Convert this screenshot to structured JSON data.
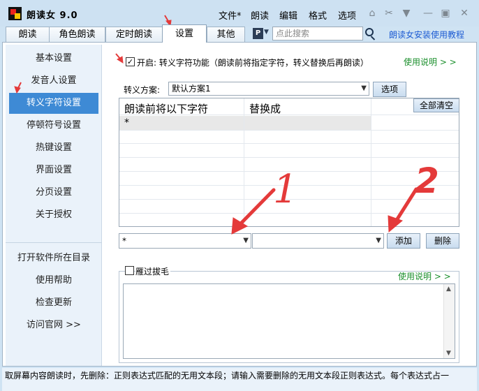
{
  "app": {
    "title": "朗读女  9.0"
  },
  "menu": [
    "文件*",
    "朗读",
    "编辑",
    "格式",
    "选项"
  ],
  "tabs": [
    "朗读",
    "角色朗读",
    "定时朗读",
    "设置",
    "其他"
  ],
  "search": {
    "placeholder": "点此搜索"
  },
  "tutorial_link": "朗读女安装使用教程",
  "sidebar": {
    "items": [
      "基本设置",
      "发音人设置",
      "转义字符设置",
      "停顿符号设置",
      "热键设置",
      "界面设置",
      "分页设置",
      "关于授权"
    ],
    "links": [
      "打开软件所在目录",
      "使用帮助",
      "检查更新",
      "访问官网 >>"
    ]
  },
  "escape": {
    "enable_label": "开启: 转义字符功能（朗读前将指定字符，转义替换后再朗读）",
    "help": "使用说明 > >",
    "scheme_label": "转义方案:",
    "scheme_value": "默认方案1",
    "options_button": "选项",
    "table": {
      "col_source": "朗读前将以下字符",
      "col_replace": "替换成",
      "clear_all": "全部清空",
      "rows": [
        {
          "source": "*",
          "replace": ""
        }
      ]
    },
    "input_source": "*",
    "input_replace": "",
    "add_button": "添加",
    "delete_button": "删除"
  },
  "skip": {
    "label": "雁过拔毛",
    "help": "使用说明 > >"
  },
  "status": "取屏幕内容朗读时，先删除：正则表达式匹配的无用文本段；请输入需要删除的无用文本段正则表达式。每个表达式占一",
  "annotations": [
    "1",
    "2"
  ],
  "colors": {
    "accent": "#3e8ad5",
    "help_green": "#1b8f2c",
    "link_blue": "#1c5bd3",
    "arrow_red": "#e43a3a"
  }
}
